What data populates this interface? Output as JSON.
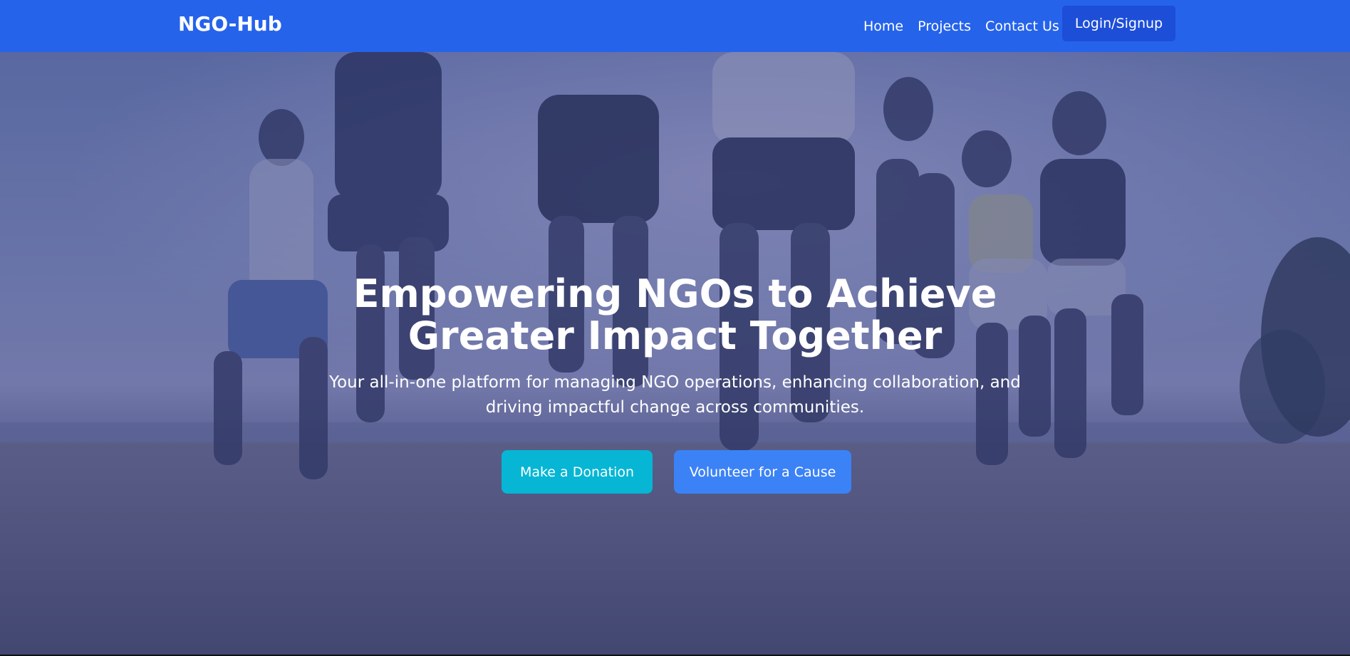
{
  "navbar": {
    "brand": "NGO-Hub",
    "links": [
      {
        "label": "Home"
      },
      {
        "label": "Projects"
      },
      {
        "label": "Contact Us"
      }
    ],
    "cta_label": "Login/Signup",
    "bg_color": "#2563eb",
    "cta_color": "#1d4ed8"
  },
  "hero": {
    "title_line1": "Empowering NGOs to Achieve",
    "title_line2": "Greater Impact Together",
    "subtitle": "Your all-in-one platform for managing NGO operations, enhancing collaboration, and driving impactful change across communities.",
    "buttons": {
      "donate_label": "Make a Donation",
      "volunteer_label": "Volunteer for a Cause"
    },
    "donate_color": "#06b6d4",
    "volunteer_color": "#3b82f6",
    "background_image": "people-jumping-on-beach-photo"
  }
}
